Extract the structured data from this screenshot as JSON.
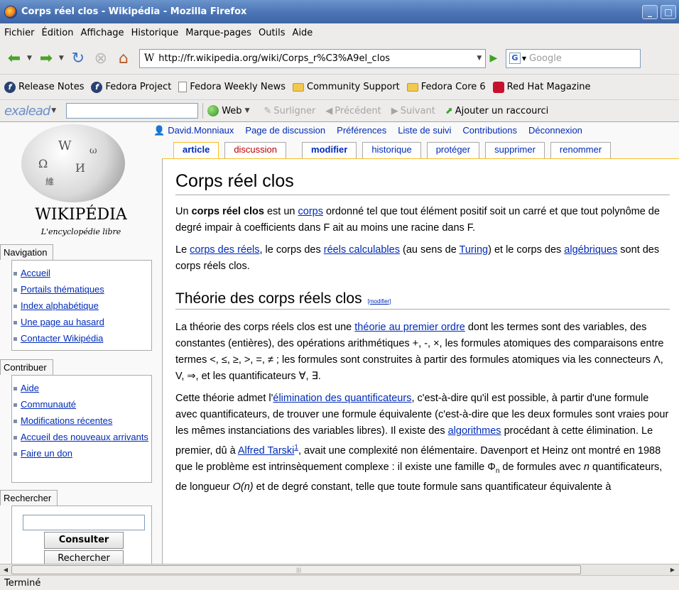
{
  "window": {
    "title": "Corps réel clos - Wikipédia - Mozilla Firefox",
    "minimize": "_",
    "maximize": "□"
  },
  "menu": [
    "Fichier",
    "Édition",
    "Affichage",
    "Historique",
    "Marque-pages",
    "Outils",
    "Aide"
  ],
  "nav": {
    "url": "http://fr.wikipedia.org/wiki/Corps_r%C3%A9el_clos",
    "favicon": "W",
    "search_engine": "G",
    "search_placeholder": "Google"
  },
  "bookmarks": [
    {
      "label": "Release Notes",
      "icon": "fedora-icon"
    },
    {
      "label": "Fedora Project",
      "icon": "fedora-icon"
    },
    {
      "label": "Fedora Weekly News",
      "icon": "page-icon"
    },
    {
      "label": "Community Support",
      "icon": "folder-icon"
    },
    {
      "label": "Fedora Core 6",
      "icon": "folder-icon"
    },
    {
      "label": "Red Hat Magazine",
      "icon": "redhat-icon"
    }
  ],
  "exalead": {
    "logo": "exalead",
    "web": "Web",
    "highlight": "Surligner",
    "previous": "Précédent",
    "next": "Suivant",
    "add_shortcut": "Ajouter un raccourci"
  },
  "sidebar": {
    "wiki_name": "WIKIPÉDIA",
    "wiki_sub": "L'encyclopédie libre",
    "navigation": {
      "title": "Navigation",
      "items": [
        "Accueil",
        "Portails thématiques",
        "Index alphabétique",
        "Une page au hasard",
        "Contacter Wikipédia"
      ]
    },
    "contribute": {
      "title": "Contribuer",
      "items": [
        "Aide",
        "Communauté",
        "Modifications récentes",
        "Accueil des nouveaux arrivants",
        "Faire un don"
      ]
    },
    "search": {
      "title": "Rechercher",
      "go": "Consulter",
      "search": "Rechercher"
    }
  },
  "personal": [
    "David.Monniaux",
    "Page de discussion",
    "Préférences",
    "Liste de suivi",
    "Contributions",
    "Déconnexion"
  ],
  "tabs": [
    "article",
    "discussion",
    "modifier",
    "historique",
    "protéger",
    "supprimer",
    "renommer"
  ],
  "article": {
    "title": "Corps réel clos",
    "p1": {
      "a": "Un ",
      "b": "corps réel clos",
      "c": " est un ",
      "link": "corps",
      "d": " ordonné tel que tout élément positif soit un carré et que tout polynôme de degré impair à coefficients dans F ait au moins une racine dans F."
    },
    "p2": {
      "a": "Le ",
      "l1": "corps des réels",
      "b": ", le corps des ",
      "l2": "réels calculables",
      "c": " (au sens de ",
      "l3": "Turing",
      "d": ") et le corps des ",
      "l4": "algébriques",
      "e": " sont des corps réels clos."
    },
    "h2": "Théorie des corps réels clos",
    "edit": "[modifier]",
    "p3": {
      "a": "La théorie des corps réels clos est une ",
      "l1": "théorie au premier ordre",
      "b": " dont les termes sont des variables, des constantes (entières), des opérations arithmétiques +, -, ×, les formules atomiques des comparaisons entre termes <, ≤, ≥, >, =, ≠ ; les formules sont construites à partir des formules atomiques via les connecteurs Λ, V, ⇒, et les quantificateurs ∀, ∃."
    },
    "p4": {
      "a": "Cette théorie admet l'",
      "l1": "élimination des quantificateurs",
      "b": ", c'est-à-dire qu'il est possible, à partir d'une formule avec quantificateurs, de trouver une formule équivalente (c'est-à-dire que les deux formules sont vraies pour les mêmes instanciations des variables libres). Il existe des ",
      "l2": "algorithmes",
      "c": " procédant à cette élimination. Le premier, dû à ",
      "l3": "Alfred Tarski",
      "sup": "1",
      "d": ", avait une complexité non élémentaire. Davenport et Heinz ont montré en 1988 que le problème est intrinsèquement complexe : il existe une famille Φ",
      "sub": "n",
      "e": " de formules avec ",
      "n": "n",
      "f": " quantificateurs, de longueur ",
      "on": "O(n)",
      "g": " et de degré constant, telle que toute formule sans quantificateur équivalente à"
    }
  },
  "status": "Terminé"
}
